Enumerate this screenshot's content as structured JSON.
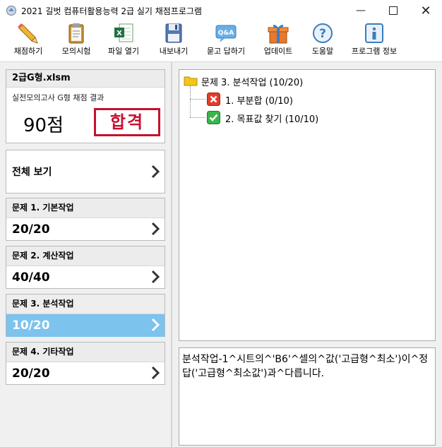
{
  "window": {
    "title": "2021 길벗 컴퓨터활용능력 2급 실기 채점프로그램",
    "icons": {
      "minimize": "minimize-icon",
      "maximize": "maximize-icon",
      "close": "close-icon"
    }
  },
  "toolbar": {
    "items": [
      {
        "label": "채점하기",
        "icon": "pencil-icon"
      },
      {
        "label": "모의시험",
        "icon": "clipboard-icon"
      },
      {
        "label": "파일 열기",
        "icon": "excel-file-icon"
      },
      {
        "label": "내보내기",
        "icon": "floppy-disk-icon"
      },
      {
        "label": "묻고 답하기",
        "icon": "qa-bubble-icon"
      },
      {
        "label": "업데이트",
        "icon": "gift-box-icon"
      },
      {
        "label": "도움말",
        "icon": "help-icon"
      },
      {
        "label": "프로그램 정보",
        "icon": "info-icon"
      }
    ]
  },
  "summary": {
    "file_name": "2급G형.xlsm",
    "subtitle": "실전모의고사 G형 채점 결과",
    "score": "90점",
    "stamp": "합격"
  },
  "overview": {
    "label": "전체 보기"
  },
  "problems": [
    {
      "title": "문제 1. 기본작업",
      "score": "20/20"
    },
    {
      "title": "문제 2. 계산작업",
      "score": "40/40"
    },
    {
      "title": "문제 3. 분석작업",
      "score": "10/20"
    },
    {
      "title": "문제 4. 기타작업",
      "score": "20/20"
    }
  ],
  "tree": {
    "root": "문제 3. 분석작업 (10/20)",
    "children": [
      {
        "label": "1. 부분합 (0/10)",
        "status": "fail"
      },
      {
        "label": "2. 목표값 찾기 (10/10)",
        "status": "pass"
      }
    ]
  },
  "message": {
    "text": "분석작업-1^시트의^'B6'^셀의^값('고급형^최소')이^정답('고급형^최소값')과^다릅니다."
  },
  "colors": {
    "active": "#7cc3ee",
    "stamp": "#c8102e",
    "fail": "#e23b2a",
    "pass": "#39b54a",
    "folder": "#f5c518"
  }
}
